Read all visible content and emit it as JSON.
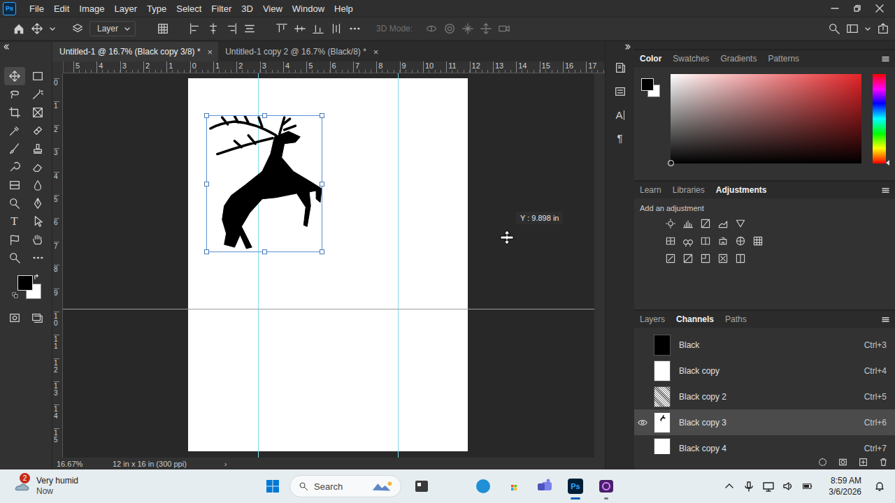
{
  "app": {
    "logo": "Ps"
  },
  "menu_bar": {
    "items": [
      "File",
      "Edit",
      "Image",
      "Layer",
      "Type",
      "Select",
      "Filter",
      "3D",
      "View",
      "Window",
      "Help"
    ]
  },
  "options_bar": {
    "auto_select": "Layer",
    "mode_3d": {
      "label": "3D Mode:",
      "disabled": true
    }
  },
  "document_tabs": [
    {
      "label": "Untitled-1 @ 16.7% (Black copy 3/8) *",
      "selected": true,
      "close": "×"
    },
    {
      "label": "Untitled-1 copy 2 @ 16.7% (Black/8) *",
      "selected": false,
      "close": "×"
    }
  ],
  "tools": {
    "type_glyph": "T"
  },
  "rulers": {
    "horizontal": [
      "5",
      "4",
      "3",
      "2",
      "1",
      "0",
      "1",
      "2",
      "3",
      "4",
      "5",
      "6",
      "7",
      "8",
      "9",
      "10",
      "11",
      "12",
      "13",
      "14",
      "15",
      "16",
      "17"
    ],
    "vertical": [
      "0",
      "1",
      "2",
      "3",
      "4",
      "5",
      "6",
      "7",
      "8",
      "9",
      "10",
      "11",
      "12",
      "13",
      "14",
      "15"
    ]
  },
  "canvas": {
    "tooltip": "Y : 9.898 in"
  },
  "status_bar": {
    "zoom": "16.67%",
    "document_size": "12 in x 16 in (300 ppi)",
    "arrow": "›"
  },
  "side_strip": {
    "glyphs": [
      "A",
      "¶"
    ]
  },
  "color_panel": {
    "tabs": [
      {
        "label": "Color",
        "selected": true
      },
      {
        "label": "Swatches",
        "selected": false
      },
      {
        "label": "Gradients",
        "selected": false
      },
      {
        "label": "Patterns",
        "selected": false
      }
    ]
  },
  "adjustments_panel": {
    "tabs": [
      {
        "label": "Learn",
        "selected": false
      },
      {
        "label": "Libraries",
        "selected": false
      },
      {
        "label": "Adjustments",
        "selected": true
      }
    ],
    "hint": "Add an adjustment"
  },
  "channels_panel": {
    "tabs": [
      {
        "label": "Layers",
        "selected": false
      },
      {
        "label": "Channels",
        "selected": true
      },
      {
        "label": "Paths",
        "selected": false
      }
    ],
    "channels": [
      {
        "name": "Black",
        "shortcut": "Ctrl+3",
        "visible": false,
        "selected": false,
        "kind": "black"
      },
      {
        "name": "Black copy",
        "shortcut": "Ctrl+4",
        "visible": false,
        "selected": false,
        "kind": "white"
      },
      {
        "name": "Black copy 2",
        "shortcut": "Ctrl+5",
        "visible": false,
        "selected": false,
        "kind": "noise"
      },
      {
        "name": "Black copy 3",
        "shortcut": "Ctrl+6",
        "visible": true,
        "selected": true,
        "kind": "deer"
      },
      {
        "name": "Black copy 4",
        "shortcut": "Ctrl+7",
        "visible": false,
        "selected": false,
        "kind": "white"
      }
    ]
  },
  "taskbar": {
    "weather": {
      "badge": "2",
      "title": "Very humid",
      "subtitle": "Now"
    },
    "search": {
      "placeholder": "Search"
    },
    "apps": [
      {
        "kind": "widgets",
        "running": false
      },
      {
        "kind": "folder",
        "running": false
      },
      {
        "kind": "edge",
        "running": false
      },
      {
        "kind": "store",
        "running": false
      },
      {
        "kind": "teams",
        "running": false
      },
      {
        "kind": "photoshop",
        "label": "Ps",
        "running": true
      },
      {
        "kind": "other",
        "running": true
      }
    ],
    "clock": {
      "time": "8:59 AM",
      "date": "3/6/2026"
    }
  }
}
